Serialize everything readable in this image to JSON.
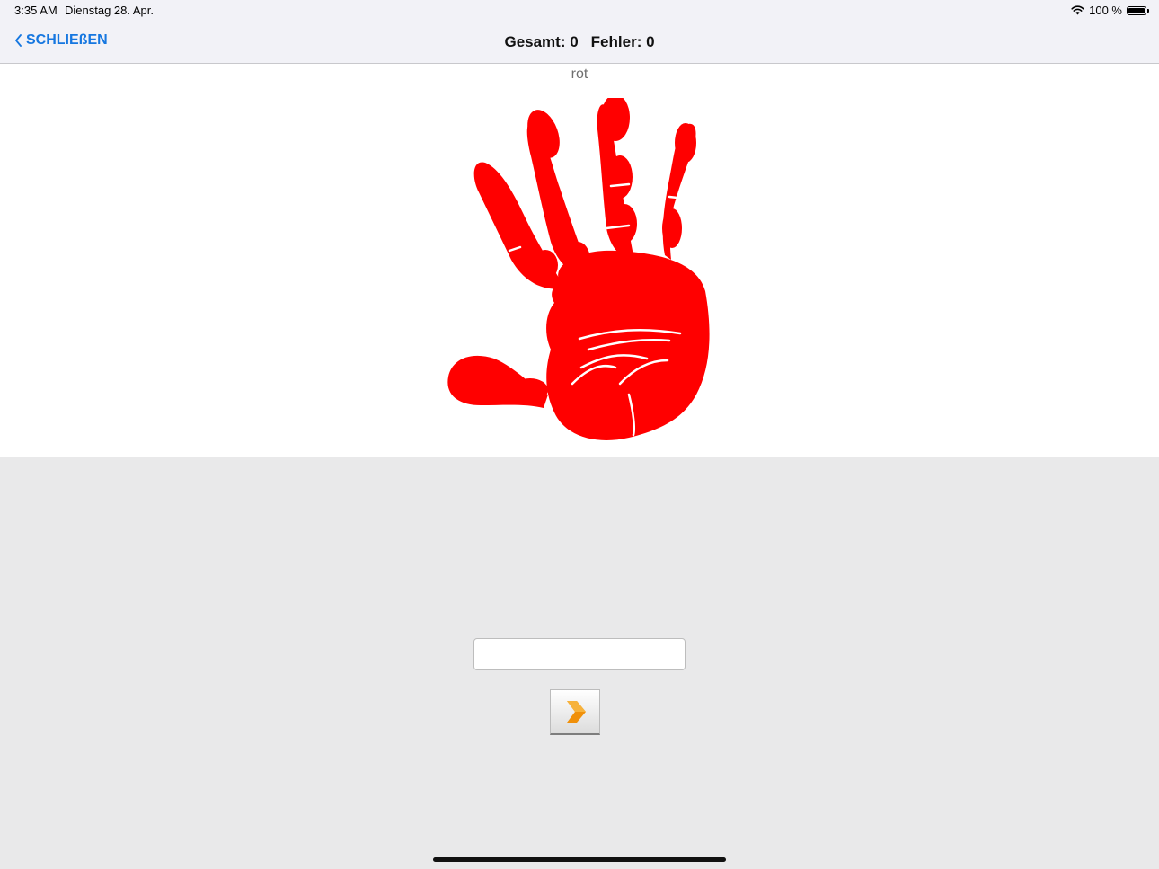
{
  "status_bar": {
    "time": "3:35 AM",
    "date": "Dienstag 28. Apr.",
    "battery": "100 %",
    "icons": [
      "wifi-icon",
      "battery-icon"
    ]
  },
  "nav": {
    "back_label": "SCHLIEßEN",
    "total_label": "Gesamt: 0",
    "errors_label": "Fehler: 0"
  },
  "card": {
    "word": "rot",
    "image": "red-handprint"
  },
  "answer": {
    "value": "",
    "placeholder": ""
  },
  "next_button": {
    "icon": "chevron-right-icon"
  },
  "colors": {
    "accent": "#1677e0",
    "hand": "#ff0000",
    "arrow": "#f0900a",
    "background": "#e9e9ea"
  }
}
